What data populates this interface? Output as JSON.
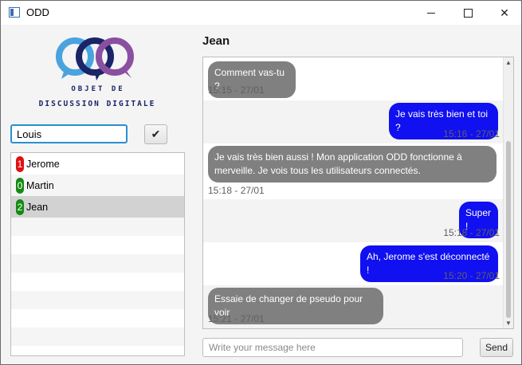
{
  "window": {
    "title": "ODD"
  },
  "logo": {
    "top_line": "OBJET DE",
    "bottom_line": "DISCUSSION DIGITALE",
    "colors": [
      "#4aa3df",
      "#1a2466",
      "#8b4fa0"
    ]
  },
  "login": {
    "pseudo": "Louis",
    "confirm_icon": "check-icon",
    "confirm_glyph": "✔"
  },
  "users": [
    {
      "name": "Jerome",
      "count": "1",
      "badge_color": "#e01010"
    },
    {
      "name": "Martin",
      "count": "0",
      "badge_color": "#138a13"
    },
    {
      "name": "Jean",
      "count": "2",
      "badge_color": "#138a13",
      "selected": true
    }
  ],
  "chat": {
    "title": "Jean",
    "messages": [
      {
        "direction": "received",
        "text": "Comment vas-tu ?",
        "time": "15:15 - 27/01"
      },
      {
        "direction": "sent",
        "text": "Je vais très bien et toi ?",
        "time": "15:16 - 27/01"
      },
      {
        "direction": "received",
        "text": "Je vais très bien aussi ! Mon application ODD fonctionne à merveille. Je vois tous les utilisateurs connectés.",
        "time": "15:18 - 27/01"
      },
      {
        "direction": "sent",
        "text": "Super !",
        "time": "15:18 - 27/01"
      },
      {
        "direction": "sent",
        "text": "Ah, Jerome s'est déconnecté !",
        "time": "15:20 - 27/01"
      },
      {
        "direction": "received",
        "text": "Essaie de changer de pseudo pour voir",
        "time": "15:21 - 27/01"
      }
    ]
  },
  "composer": {
    "placeholder": "Write your message here",
    "value": "",
    "send_label": "Send"
  },
  "colors": {
    "sent_bubble": "#1010f0",
    "received_bubble": "#808080",
    "focus": "#2b8fd6"
  }
}
